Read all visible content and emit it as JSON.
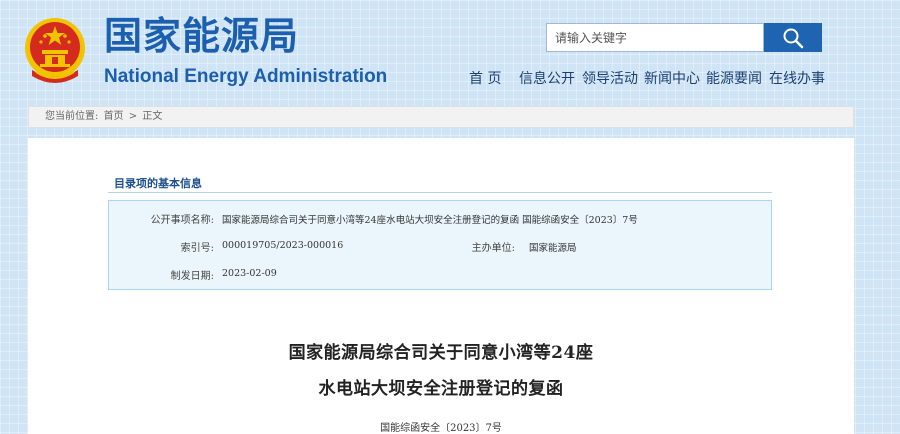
{
  "header": {
    "logo_cn": "国家能源局",
    "logo_en": "National Energy Administration",
    "search_placeholder": "请输入关键字",
    "nav": [
      {
        "label": "首 页"
      },
      {
        "label": "信息公开"
      },
      {
        "label": "领导活动"
      },
      {
        "label": "新闻中心"
      },
      {
        "label": "能源要闻"
      },
      {
        "label": "在线办事"
      }
    ],
    "colors": {
      "brand_blue": "#1b5fae",
      "search_button": "#1f64b0",
      "emblem_red": "#d52b1e",
      "emblem_gold": "#f2c300"
    }
  },
  "breadcrumb": {
    "prefix": "您当前位置:",
    "items": [
      "首页",
      "正文"
    ],
    "separator": ">"
  },
  "info": {
    "section_title": "目录项的基本信息",
    "rows": {
      "subject_label": "公开事项名称:",
      "subject_value": "国家能源局综合司关于同意小湾等24座水电站大坝安全注册登记的复函 国能综函安全〔2023〕7号",
      "index_label": "索引号:",
      "index_value": "000019705/2023-000016",
      "org_label": "主办单位:",
      "org_value": "国家能源局",
      "date_label": "制发日期:",
      "date_value": "2023-02-09"
    }
  },
  "document": {
    "title_line1": "国家能源局综合司关于同意小湾等24座",
    "title_line2": "水电站大坝安全注册登记的复函",
    "doc_number": "国能综函安全〔2023〕7号"
  },
  "icons": {
    "emblem": "national-emblem-icon",
    "search": "search-icon"
  }
}
